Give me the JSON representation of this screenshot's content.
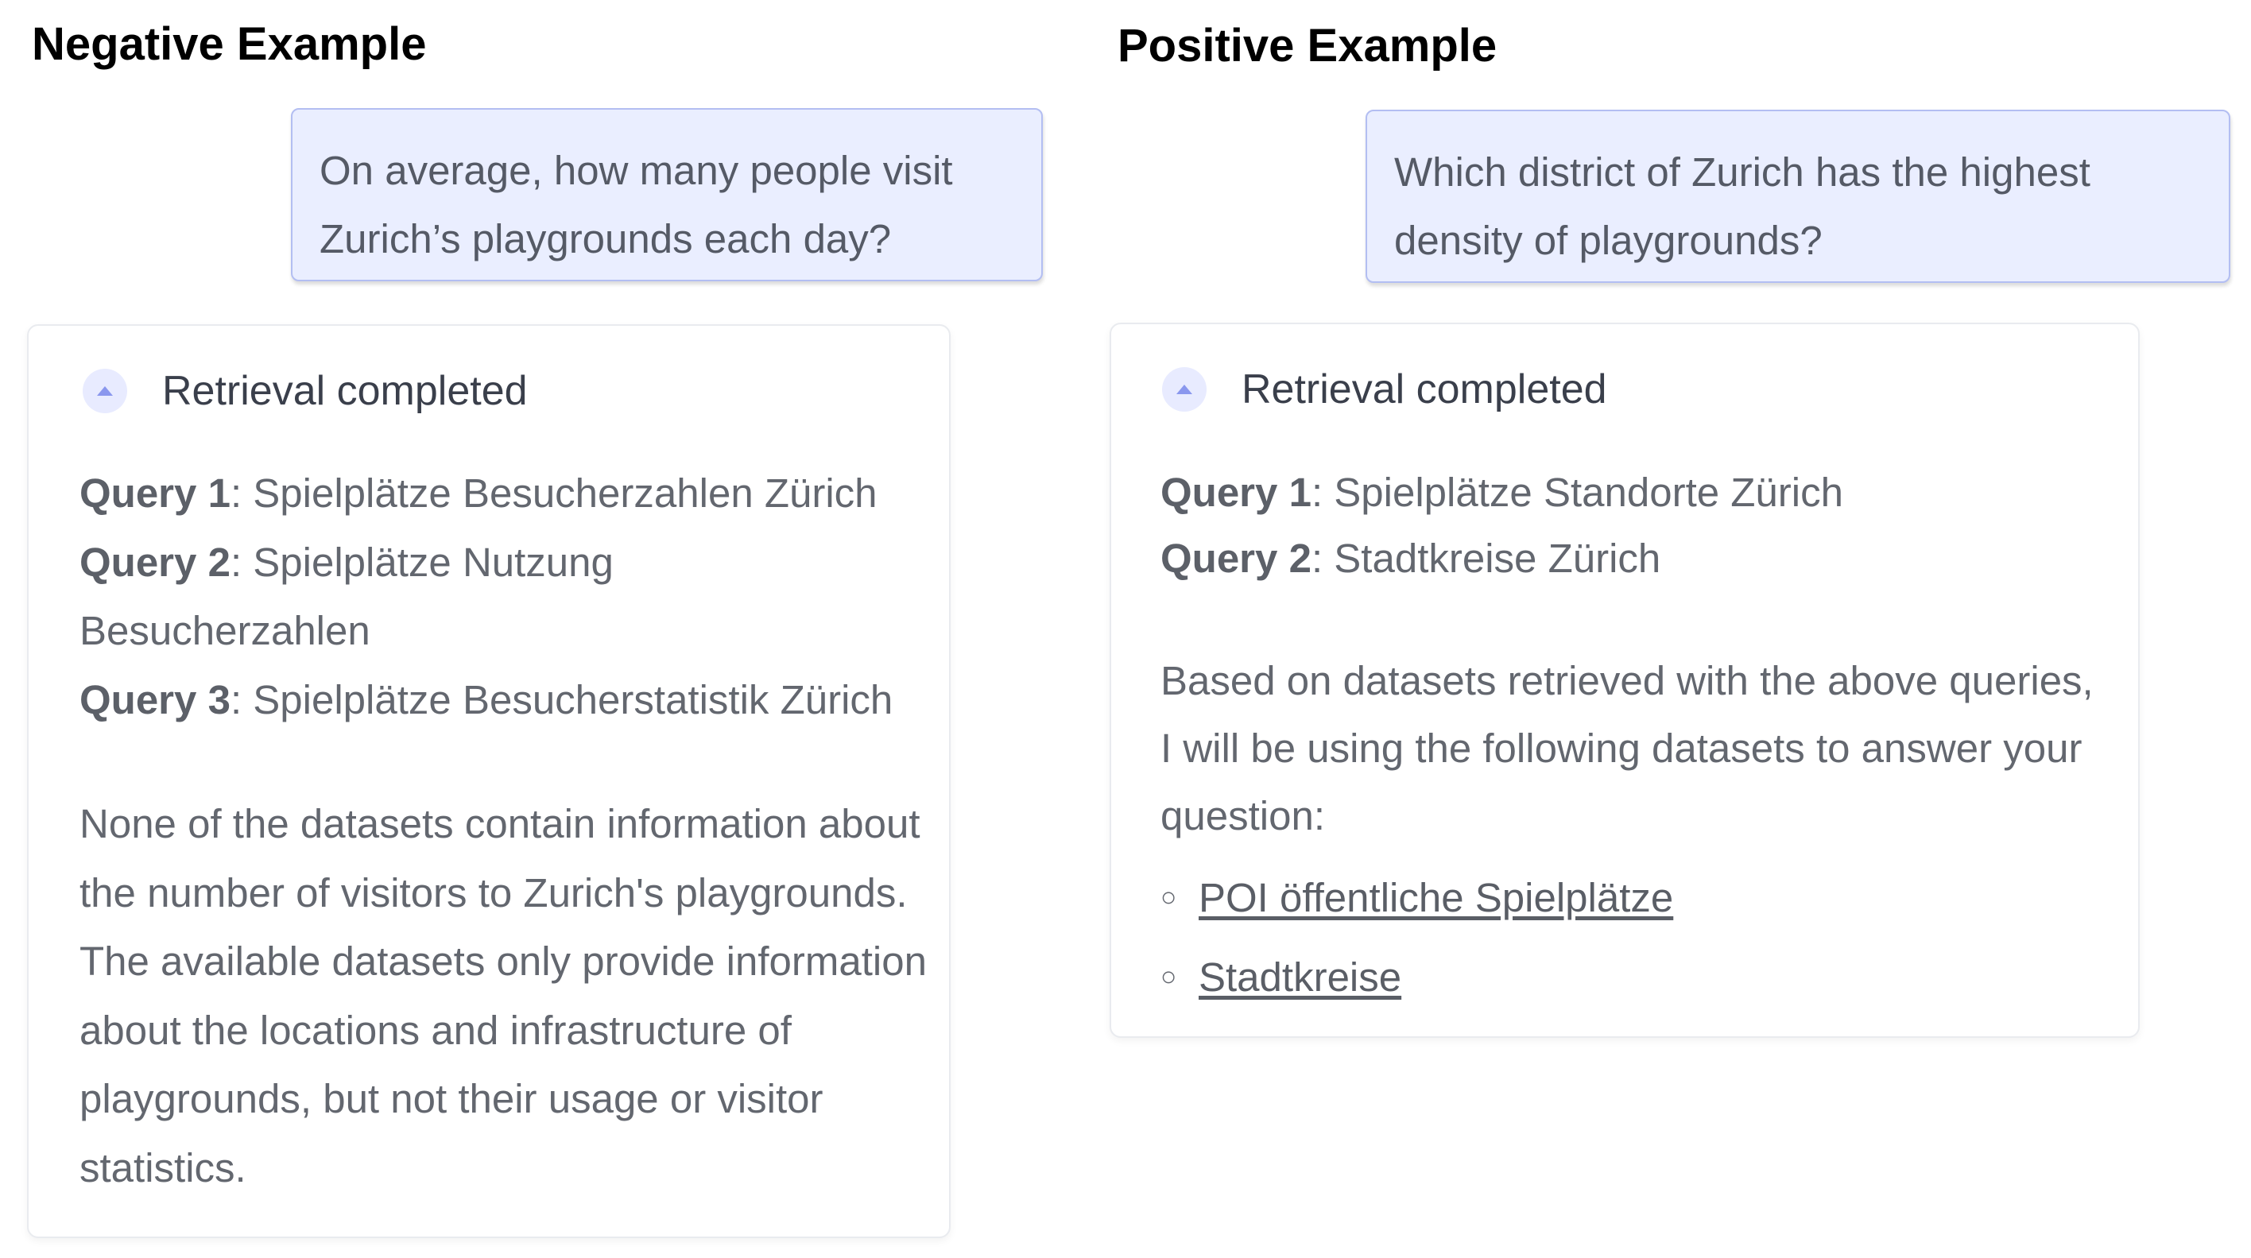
{
  "negative": {
    "section_title": "Negative Example",
    "user_message": "On average, how many people visit Zurich’s playgrounds each day?",
    "status": "Retrieval completed",
    "queries": [
      {
        "label": "Query 1",
        "text": ": Spielplätze Besucherzahlen Zürich"
      },
      {
        "label": "Query 2",
        "text": ": Spielplätze Nutzung"
      },
      {
        "label": "",
        "text": "Besucherzahlen"
      },
      {
        "label": "Query 3",
        "text": ": Spielplätze Besucherstatistik Zürich"
      }
    ],
    "response": "None of the datasets contain information about the number of visitors to Zurich's playgrounds. The available datasets only provide information about the locations and infrastructure of playgrounds, but not their usage or visitor statistics."
  },
  "positive": {
    "section_title": "Positive Example",
    "user_message": "Which district of Zurich has the highest density of playgrounds?",
    "status": "Retrieval completed",
    "queries": [
      {
        "label": "Query 1",
        "text": ": Spielplätze Standorte Zürich"
      },
      {
        "label": "Query 2",
        "text": ": Stadtkreise Zürich"
      }
    ],
    "response": "Based on datasets retrieved with the above queries, I will be using the following datasets to answer your question:",
    "datasets": [
      {
        "name": "POI öffentliche Spielplätze"
      },
      {
        "name": "Stadtkreise"
      }
    ]
  },
  "icons": {
    "toggle": "chevron-up-icon",
    "bullet": "hollow-circle-bullet"
  },
  "colors": {
    "bubble_bg": "#eaeeff",
    "bubble_border": "#b3bef2",
    "accent": "#8a97ee",
    "text_muted": "#63676f"
  }
}
